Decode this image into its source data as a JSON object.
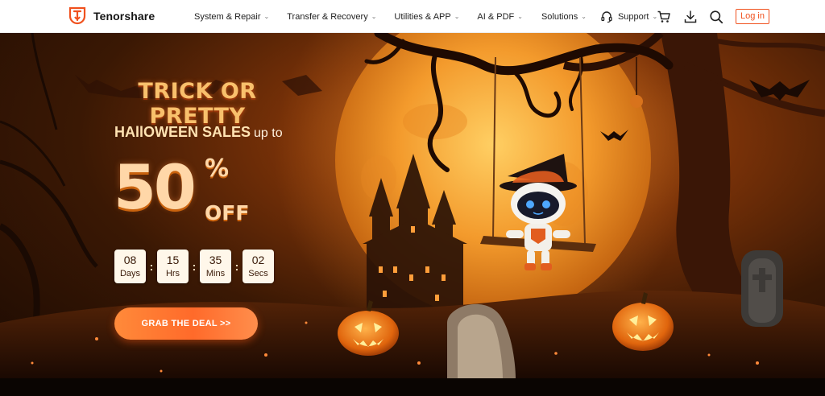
{
  "brand": {
    "name": "Tenorshare",
    "accent": "#f0511e"
  },
  "nav": {
    "items": [
      {
        "label": "System & Repair"
      },
      {
        "label": "Transfer & Recovery"
      },
      {
        "label": "Utilities & APP"
      },
      {
        "label": "AI & PDF"
      },
      {
        "label": "Solutions"
      },
      {
        "label": "Support"
      }
    ],
    "login_label": "Log in",
    "icons": [
      "cart-icon",
      "download-icon",
      "search-icon",
      "headset-icon"
    ]
  },
  "hero": {
    "title": "TRICK OR PRETTY",
    "subtitle_strong": "HAllOWEEN SALES",
    "subtitle_rest": "up to",
    "discount_number": "50",
    "discount_symbol": "%",
    "discount_off": "OFF",
    "countdown": [
      {
        "value": "08",
        "unit": "Days"
      },
      {
        "value": "15",
        "unit": "Hrs"
      },
      {
        "value": "35",
        "unit": "Mins"
      },
      {
        "value": "02",
        "unit": "Secs"
      }
    ],
    "countdown_separator": ":",
    "cta_label": "GRAB THE DEAL >>",
    "colors": {
      "cta": "#ff7034",
      "moon": "#f29a2e",
      "background": "#3a1804"
    }
  }
}
